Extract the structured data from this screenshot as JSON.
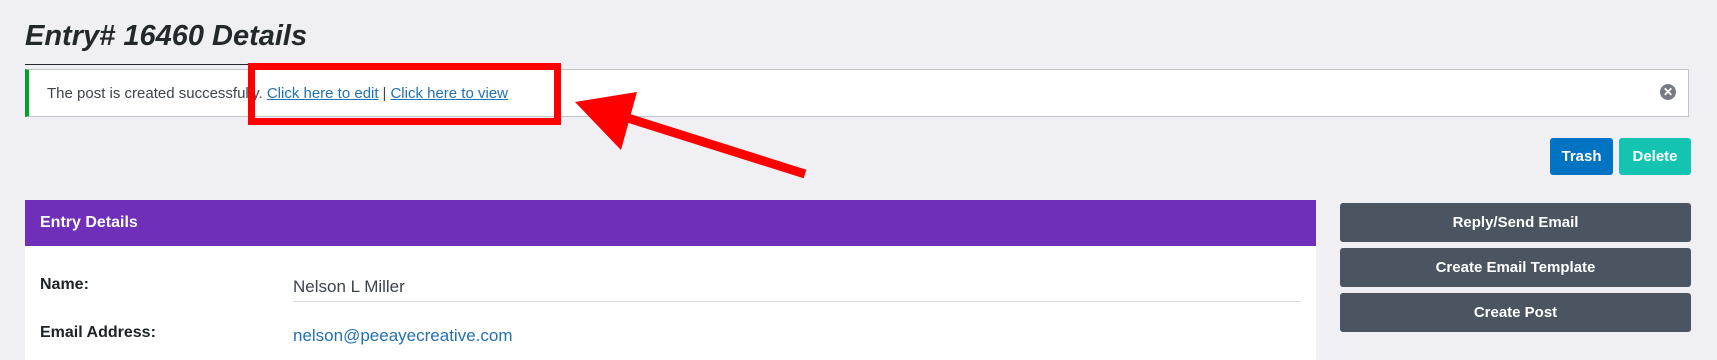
{
  "page": {
    "title": "Entry# 16460 Details"
  },
  "notice": {
    "message": "The post is created successfully.",
    "edit_link": "Click here to edit",
    "separator": "|",
    "view_link": "Click here to view",
    "dismiss_icon": "close-circle-icon"
  },
  "actions": {
    "trash_label": "Trash",
    "delete_label": "Delete"
  },
  "entry_details": {
    "header": "Entry Details",
    "fields": [
      {
        "label": "Name:",
        "value": "Nelson L Miller"
      },
      {
        "label": "Email Address:",
        "value": "nelson@peeayecreative.com"
      }
    ]
  },
  "sidebar": {
    "buttons": [
      {
        "label": "Reply/Send Email"
      },
      {
        "label": "Create Email Template"
      },
      {
        "label": "Create Post"
      }
    ]
  },
  "annotation": {
    "color": "#ff0000"
  },
  "colors": {
    "header_purple": "#6f2fb9",
    "trash_blue": "#0073c2",
    "delete_teal": "#14c3b0",
    "sidebar_button": "#4a5561",
    "success_border": "#00a32a"
  }
}
